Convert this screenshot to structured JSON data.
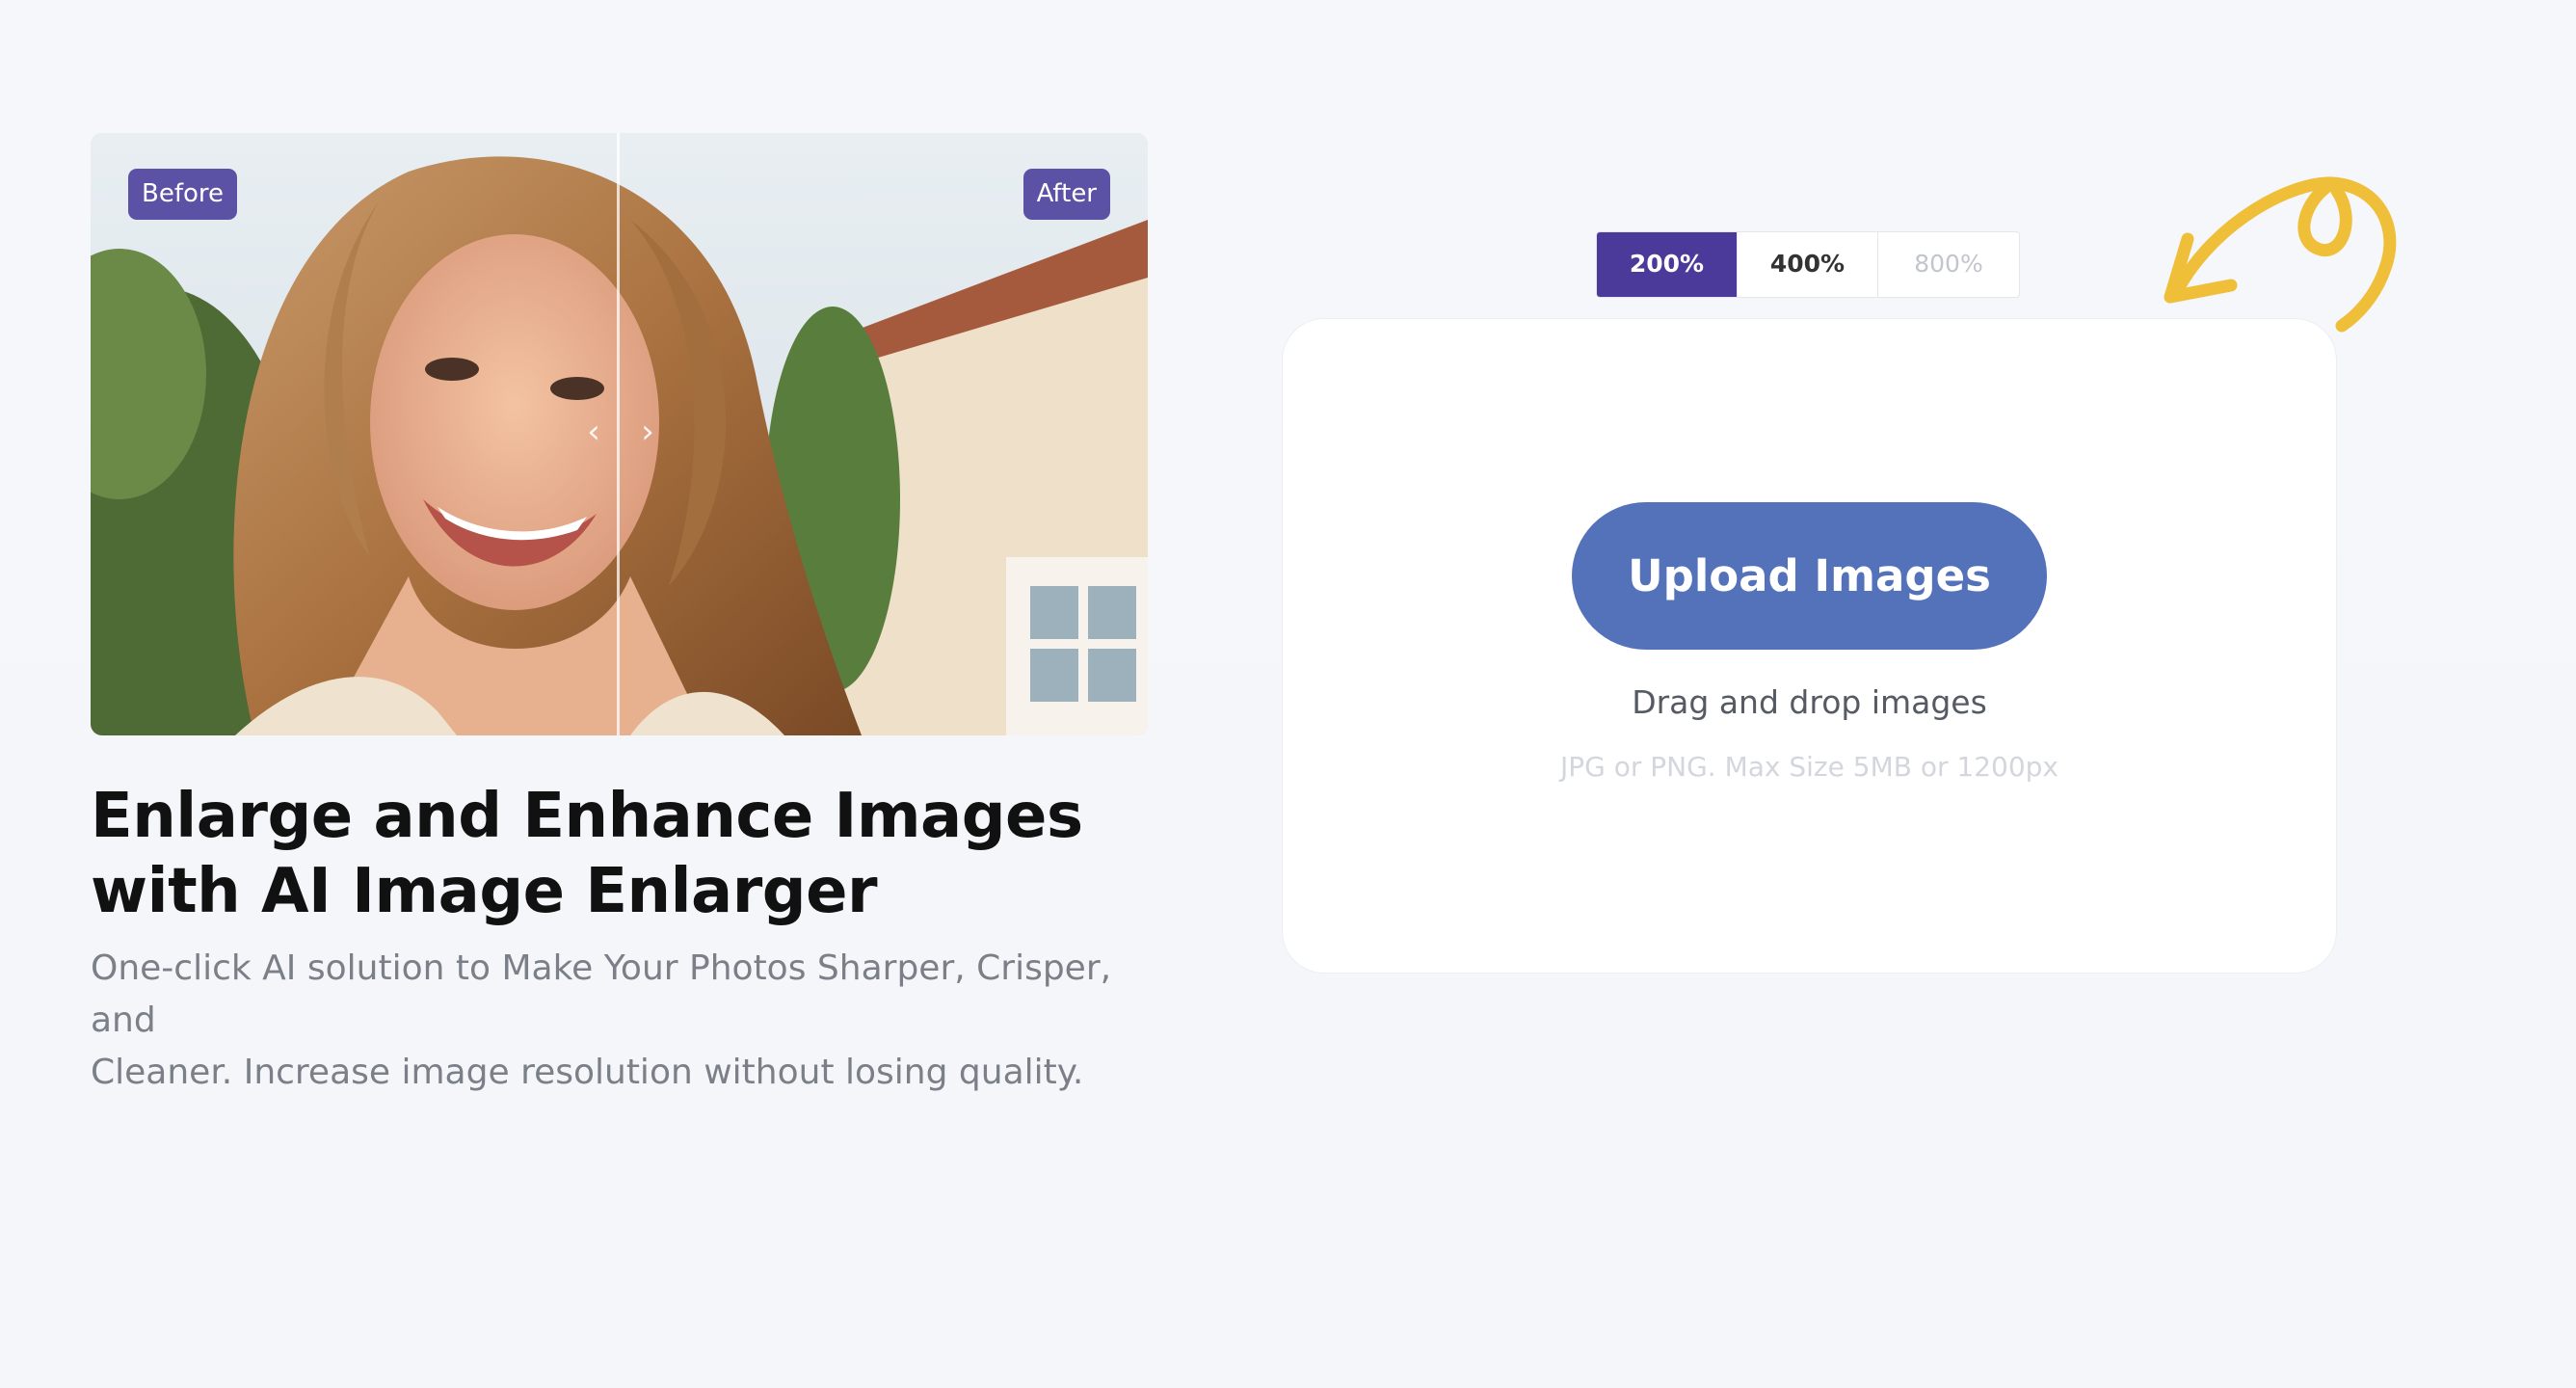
{
  "compare": {
    "before_label": "Before",
    "after_label": "After",
    "left_arrow": "‹",
    "right_arrow": "›"
  },
  "hero": {
    "title_line1": "Enlarge and Enhance Images",
    "title_line2": "with AI Image Enlarger",
    "subtitle_line1": "One-click AI solution to Make Your Photos Sharper, Crisper, and",
    "subtitle_line2": "Cleaner. Increase image resolution without losing quality."
  },
  "scales": [
    {
      "label": "200%",
      "state": "selected"
    },
    {
      "label": "400%",
      "state": "normal"
    },
    {
      "label": "800%",
      "state": "disabled"
    }
  ],
  "upload": {
    "button_label": "Upload Images",
    "drag_text": "Drag and drop images",
    "hint_text": "JPG or PNG. Max Size 5MB or 1200px"
  },
  "colors": {
    "accent_purple": "#4b3a9a",
    "tag_purple": "#5b52a6",
    "upload_blue": "#5472ba",
    "doodle_yellow": "#f0bf3a"
  },
  "icons": {
    "doodle": "curly-arrow-icon",
    "slider_left": "chevron-left-icon",
    "slider_right": "chevron-right-icon"
  }
}
